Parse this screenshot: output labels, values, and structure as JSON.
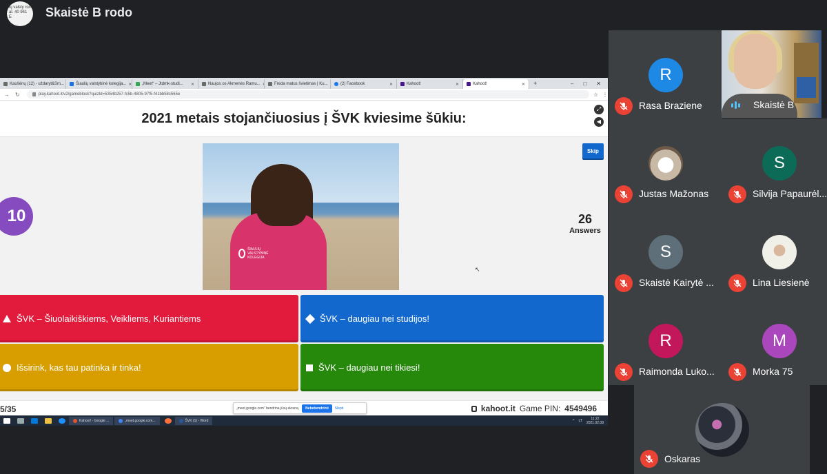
{
  "presenter": {
    "avatar_text": "ių valsty ros al. 40 941 E",
    "title": "Skaistė B rodo"
  },
  "browser": {
    "tabs": [
      {
        "label": "Kaušėnų (12) - uždaryt&Sm..."
      },
      {
        "label": "Šiaulių valstybinė kolegija..."
      },
      {
        "label": "„Meet“ – Jtdmk-studi..."
      },
      {
        "label": "Naujos os Akmenės Ramu..."
      },
      {
        "label": "Freda matus švietimas | Ku..."
      },
      {
        "label": "(2) Facebook"
      },
      {
        "label": "Kahoot!"
      },
      {
        "label": "Kahoot!"
      }
    ],
    "url": "play.kahoot.it/v2/gameblock?quizId=5354b257-fc5b-4805-97f5-f41bb58c565e"
  },
  "kahoot": {
    "question": "2021 metais stojančiuosius į ŠVK kviesime šūkiu:",
    "timer": "10",
    "skip_label": "Skip",
    "answers_count": "26",
    "answers_label": "Answers",
    "hoodie_text": "ŠIAULIŲ VALSTYBINĖ KOLEGIJA",
    "options": [
      {
        "text": "ŠVK – Šiuolaikiškiems, Veikliems, Kuriantiems",
        "shape": "triangle",
        "color": "#e21b3c"
      },
      {
        "text": "ŠVK – daugiau nei studijos!",
        "shape": "diamond",
        "color": "#1368ce"
      },
      {
        "text": "Išsirink, kas tau patinka ir tinka!",
        "shape": "circle",
        "color": "#d89e00"
      },
      {
        "text": "ŠVK – daugiau nei tikiesi!",
        "shape": "square",
        "color": "#26890c"
      }
    ],
    "progress": "5/35",
    "brand": "kahoot.it",
    "pin_label": "Game PIN:",
    "pin": "4549496"
  },
  "share_notice": {
    "text": "„meet.google.com“ bendrina jūsų ekraną.",
    "stop_label": "Nebebendrinti",
    "hide_label": "Slėpti"
  },
  "taskbar": {
    "apps": [
      {
        "label": "Kahoot! - Google ...",
        "color": "#e0542e"
      },
      {
        "label": "„meet.google.com...",
        "color": "#4285f4"
      },
      {
        "label": "ŠVK (1) - Word",
        "color": "#2b579a"
      }
    ],
    "time": "11:22",
    "date": "2021.02.08",
    "lang": "LT"
  },
  "participants": [
    {
      "name": "Rasa Braziene",
      "initial": "R",
      "color": "#1e88e5"
    },
    {
      "name": "Skaistė B"
    },
    {
      "name": "Justas Mažonas"
    },
    {
      "name": "Silvija Papaurėl...",
      "initial": "S",
      "color": "#0b6b57"
    },
    {
      "name": "Skaistė Kairytė ...",
      "initial": "S",
      "color": "#5f6f7a"
    },
    {
      "name": "Lina Liesienė"
    },
    {
      "name": "Raimonda Luko...",
      "initial": "R",
      "color": "#c2185b"
    },
    {
      "name": "Morka 75",
      "initial": "M",
      "color": "#ab47bc"
    },
    {
      "name": "Oskaras"
    }
  ]
}
